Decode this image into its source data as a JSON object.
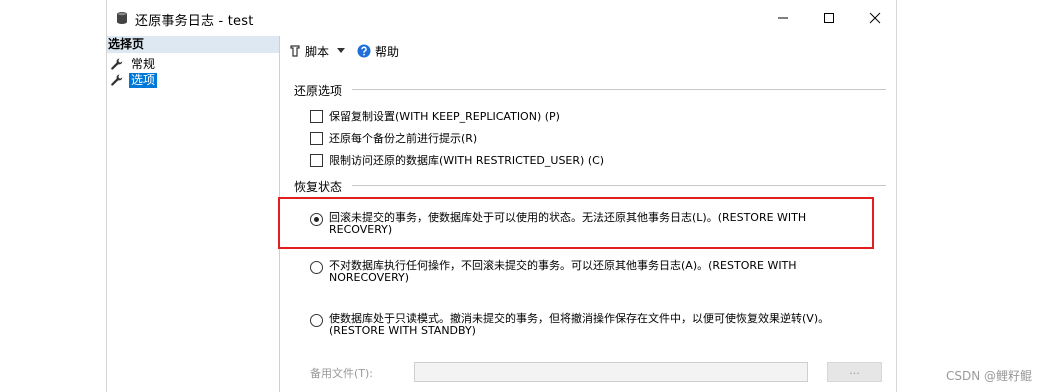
{
  "window": {
    "title": "还原事务日志  -  test"
  },
  "left_pane": {
    "header": "选择页",
    "items": [
      {
        "label": "常规",
        "selected": false
      },
      {
        "label": "选项",
        "selected": true
      }
    ]
  },
  "toolbar": {
    "script_label": "脚本",
    "help_label": "帮助"
  },
  "restore_options": {
    "heading": "还原选项",
    "checkboxes": [
      {
        "label": "保留复制设置(WITH KEEP_REPLICATION) (P)",
        "checked": false
      },
      {
        "label": "还原每个备份之前进行提示(R)",
        "checked": false
      },
      {
        "label": "限制访问还原的数据库(WITH RESTRICTED_USER) (C)",
        "checked": false
      }
    ]
  },
  "recovery_state": {
    "heading": "恢复状态",
    "radios": [
      {
        "label": "回滚未提交的事务，使数据库处于可以使用的状态。无法还原其他事务日志(L)。(RESTORE WITH RECOVERY)",
        "selected": true
      },
      {
        "label": "不对数据库执行任何操作，不回滚未提交的事务。可以还原其他事务日志(A)。(RESTORE WITH NORECOVERY)",
        "selected": false
      },
      {
        "label": "使数据库处于只读模式。撤消未提交的事务，但将撤消操作保存在文件中，以便可使恢复效果逆转(V)。(RESTORE WITH STANDBY)",
        "selected": false
      }
    ],
    "standby_file_label": "备用文件(T):",
    "standby_file_value": "",
    "browse_label": "..."
  },
  "watermark": "CSDN @鲤籽鲲",
  "colors": {
    "highlight": "#e02020",
    "selection": "#0078d7",
    "header_bg": "#dde8f3"
  }
}
